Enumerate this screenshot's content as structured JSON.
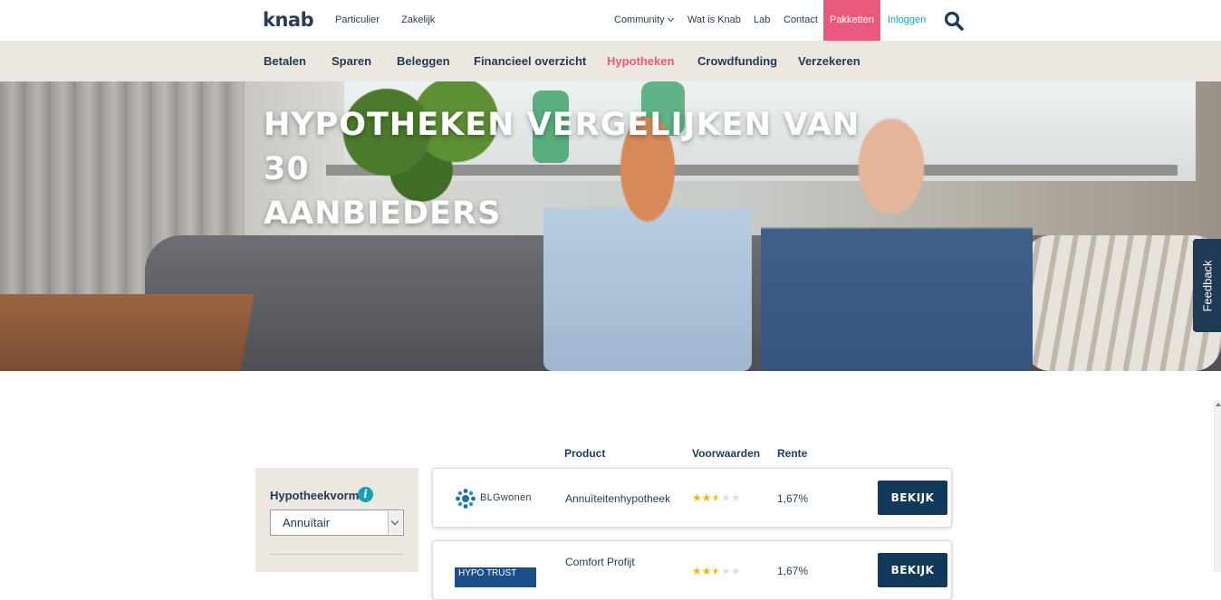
{
  "header": {
    "logo": "knab",
    "left_links": [
      "Particulier",
      "Zakelijk"
    ],
    "right_links": [
      "Community",
      "Wat is Knab",
      "Lab",
      "Contact"
    ],
    "pakketten": "Pakketten",
    "inloggen": "Inloggen",
    "search_icon": "search-icon"
  },
  "mainnav": {
    "items": [
      "Betalen",
      "Sparen",
      "Beleggen",
      "Financieel overzicht",
      "Hypotheken",
      "Crowdfunding",
      "Verzekeren"
    ],
    "active": "Hypotheken"
  },
  "hero": {
    "title_line1": "HYPOTHEKEN VERGELIJKEN VAN 30",
    "title_line2": "AANBIEDERS"
  },
  "feedback": "Feedback",
  "filters": {
    "label": "Hypotheekvorm",
    "info_icon": "info-icon",
    "select_value": "Annuïtair"
  },
  "table": {
    "headers": [
      "Product",
      "Voorwaarden",
      "Rente"
    ],
    "rows": [
      {
        "brand": "BLGwonen",
        "product": "Annuïteitenhypotheek",
        "rating": 2.5,
        "rente": "1,67%",
        "button": "BEKIJK"
      },
      {
        "brand": "HYPO TRUST",
        "product": "Comfort Profijt",
        "rating": 2.5,
        "rente": "1,67%",
        "button": "BEKIJK"
      }
    ]
  },
  "colors": {
    "accent_pink": "#e8597d",
    "navy": "#12395b",
    "teal": "#17a0b4",
    "nav_bg": "#ece7e1",
    "stars": "#f2b705"
  }
}
